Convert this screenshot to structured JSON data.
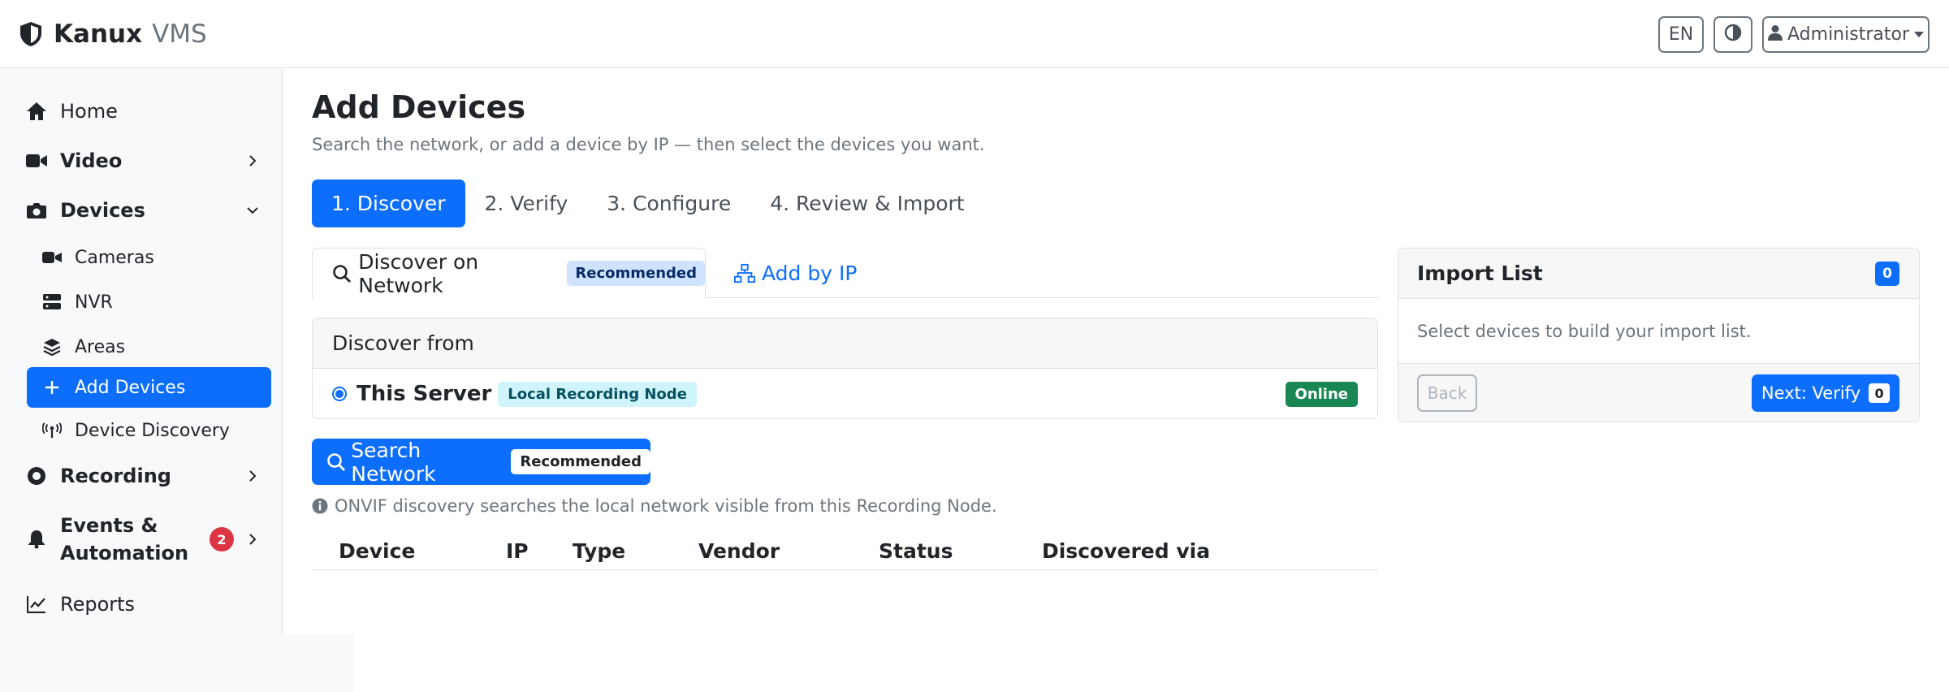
{
  "brand": {
    "name": "Kanux",
    "product": "VMS",
    "icon": "shield-icon"
  },
  "topbar": {
    "language": "EN",
    "theme_icon": "contrast-icon",
    "user_label": "Administrator",
    "user_icon": "person-icon"
  },
  "sidebar": {
    "items": [
      {
        "label": "Home",
        "icon": "home-icon"
      },
      {
        "label": "Video",
        "icon": "video-icon"
      },
      {
        "label": "Devices",
        "icon": "camera-icon"
      },
      {
        "label": "Cameras",
        "icon": "video-icon"
      },
      {
        "label": "NVR",
        "icon": "server-icon"
      },
      {
        "label": "Areas",
        "icon": "layers-icon"
      },
      {
        "label": "Add Devices",
        "icon": "plus-icon"
      },
      {
        "label": "Device Discovery",
        "icon": "broadcast-icon"
      },
      {
        "label": "Recording",
        "icon": "record-icon"
      },
      {
        "label_line1": "Events &",
        "label_line2": "Automation",
        "icon": "bell-icon",
        "badge": "2"
      },
      {
        "label": "Reports",
        "icon": "chart-line-icon"
      }
    ]
  },
  "page": {
    "title": "Add Devices",
    "subtitle": "Search the network, or add a device by IP — then select the devices you want."
  },
  "steps": [
    "1. Discover",
    "2. Verify",
    "3. Configure",
    "4. Review & Import"
  ],
  "tabs": {
    "discover": {
      "label": "Discover on Network",
      "badge": "Recommended"
    },
    "add_by_ip": {
      "label": "Add by IP"
    }
  },
  "discover_from": {
    "header": "Discover from",
    "server_name": "This Server",
    "server_tag": "Local Recording Node",
    "status": "Online"
  },
  "search": {
    "button_label": "Search Network",
    "badge": "Recommended",
    "hint": "ONVIF discovery searches the local network visible from this Recording Node."
  },
  "results_table": {
    "columns": [
      "Device",
      "IP",
      "Type",
      "Vendor",
      "Status",
      "Discovered via"
    ],
    "rows": []
  },
  "import_list": {
    "title": "Import List",
    "count": "0",
    "empty_text": "Select devices to build your import list.",
    "back_label": "Back",
    "next_label": "Next: Verify",
    "next_count": "0"
  },
  "colors": {
    "primary": "#0d6efd",
    "success": "#198754",
    "danger": "#dc3545",
    "info_bg": "#cff4fc",
    "primary_light": "#cfe2ff"
  }
}
